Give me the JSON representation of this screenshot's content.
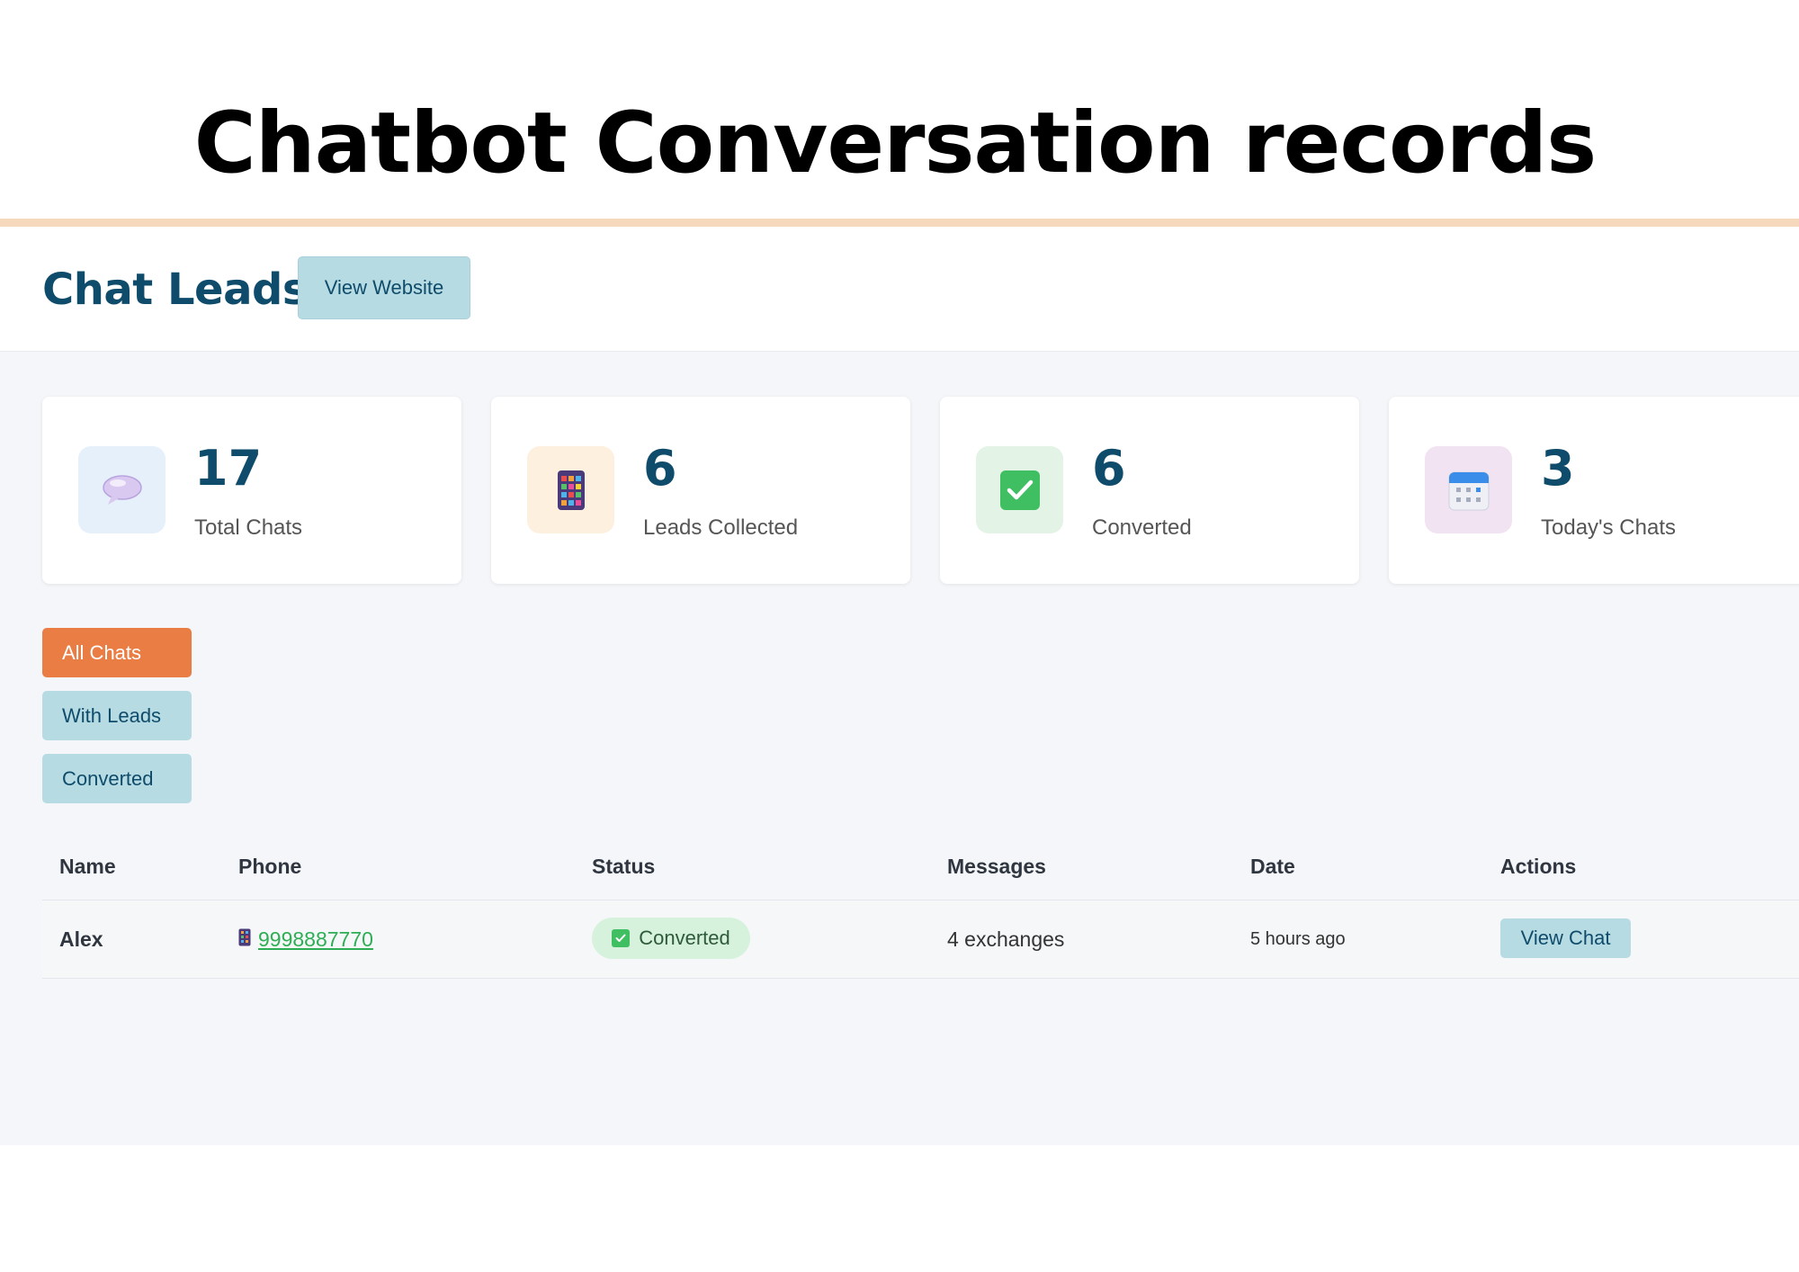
{
  "banner": {
    "title": "Chatbot Conversation records"
  },
  "header": {
    "app_title": "Chat Leads",
    "view_website_label": "View Website"
  },
  "stats": [
    {
      "value": "17",
      "label": "Total Chats",
      "icon": "speech-bubble-icon",
      "icon_bg": "#e6f0fb"
    },
    {
      "value": "6",
      "label": "Leads Collected",
      "icon": "phone-icon",
      "icon_bg": "#fdf0df"
    },
    {
      "value": "6",
      "label": "Converted",
      "icon": "checkmark-icon",
      "icon_bg": "#e3f3e6"
    },
    {
      "value": "3",
      "label": "Today's Chats",
      "icon": "calendar-icon",
      "icon_bg": "#f2e3f3"
    }
  ],
  "filters": [
    {
      "label": "All Chats",
      "active": true
    },
    {
      "label": "With Leads",
      "active": false
    },
    {
      "label": "Converted",
      "active": false
    }
  ],
  "table": {
    "columns": [
      "Name",
      "Phone",
      "Status",
      "Messages",
      "Date",
      "Actions"
    ],
    "rows": [
      {
        "name": "Alex",
        "phone": "9998887770",
        "status": "Converted",
        "messages": "4 exchanges",
        "date": "5 hours ago",
        "action": "View Chat"
      }
    ]
  },
  "colors": {
    "brand": "#0f4c6b",
    "accent": "#e97d44",
    "secondary_button": "#b7dbe3",
    "success": "#2eae54"
  }
}
